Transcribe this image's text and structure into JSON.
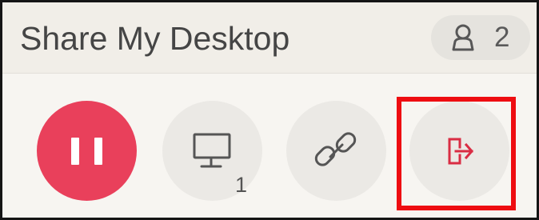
{
  "window": {
    "title": "Share My Desktop"
  },
  "participants": {
    "icon": "person-icon",
    "count": "2"
  },
  "controls": [
    {
      "name": "pause-share",
      "icon": "pause-icon",
      "color": "#e9405b"
    },
    {
      "name": "select-screen",
      "icon": "monitor-icon",
      "badge": "1"
    },
    {
      "name": "copy-link",
      "icon": "link-icon"
    },
    {
      "name": "leave-share",
      "icon": "exit-icon",
      "color": "#d92d44",
      "highlighted": true
    }
  ],
  "colors": {
    "header_background": "#f1eee8",
    "body_background": "#f7f5f1",
    "button_background": "#ebe9e5",
    "highlight": "#ee0d11"
  }
}
